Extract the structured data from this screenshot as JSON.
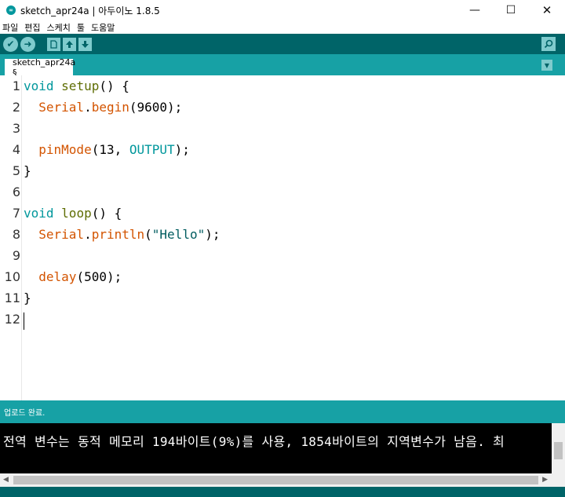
{
  "window": {
    "title": "sketch_apr24a | 아두이노 1.8.5",
    "controls": {
      "minimize": "—",
      "maximize": "☐",
      "close": "✕"
    }
  },
  "menu": [
    "파일",
    "편집",
    "스케치",
    "툴",
    "도움말"
  ],
  "toolbar": {
    "verify_icon": "check-icon",
    "upload_icon": "arrow-right-icon",
    "new_icon": "file-icon",
    "open_icon": "arrow-up-icon",
    "save_icon": "arrow-down-icon",
    "serial_monitor_icon": "magnifier-icon"
  },
  "tab": {
    "label": "sketch_apr24a §"
  },
  "editor": {
    "lines": [
      {
        "no": "1",
        "parts": [
          {
            "t": "void",
            "c": "kw"
          },
          {
            "t": " "
          },
          {
            "t": "setup",
            "c": "fn"
          },
          {
            "t": "() {"
          }
        ]
      },
      {
        "no": "2",
        "parts": [
          {
            "t": "  "
          },
          {
            "t": "Serial",
            "c": "cls"
          },
          {
            "t": "."
          },
          {
            "t": "begin",
            "c": "mt"
          },
          {
            "t": "(9600);"
          }
        ]
      },
      {
        "no": "3",
        "parts": []
      },
      {
        "no": "4",
        "parts": [
          {
            "t": "  "
          },
          {
            "t": "pinMode",
            "c": "mt"
          },
          {
            "t": "(13, "
          },
          {
            "t": "OUTPUT",
            "c": "cst"
          },
          {
            "t": ");"
          }
        ]
      },
      {
        "no": "5",
        "parts": [
          {
            "t": "}"
          }
        ]
      },
      {
        "no": "6",
        "parts": []
      },
      {
        "no": "7",
        "parts": [
          {
            "t": "void",
            "c": "kw"
          },
          {
            "t": " "
          },
          {
            "t": "loop",
            "c": "fn"
          },
          {
            "t": "() {"
          }
        ]
      },
      {
        "no": "8",
        "parts": [
          {
            "t": "  "
          },
          {
            "t": "Serial",
            "c": "cls"
          },
          {
            "t": "."
          },
          {
            "t": "println",
            "c": "mt"
          },
          {
            "t": "("
          },
          {
            "t": "\"Hello\"",
            "c": "str"
          },
          {
            "t": ");"
          }
        ]
      },
      {
        "no": "9",
        "parts": []
      },
      {
        "no": "10",
        "parts": [
          {
            "t": "  "
          },
          {
            "t": "delay",
            "c": "mt"
          },
          {
            "t": "(500);"
          }
        ]
      },
      {
        "no": "11",
        "parts": [
          {
            "t": "}"
          }
        ]
      },
      {
        "no": "12",
        "parts": []
      }
    ]
  },
  "status": {
    "message": "업로드 완료."
  },
  "console": {
    "line": "전역 변수는 동적 메모리 194바이트(9%)를 사용, 1854바이트의 지역변수가 남음.  최"
  }
}
